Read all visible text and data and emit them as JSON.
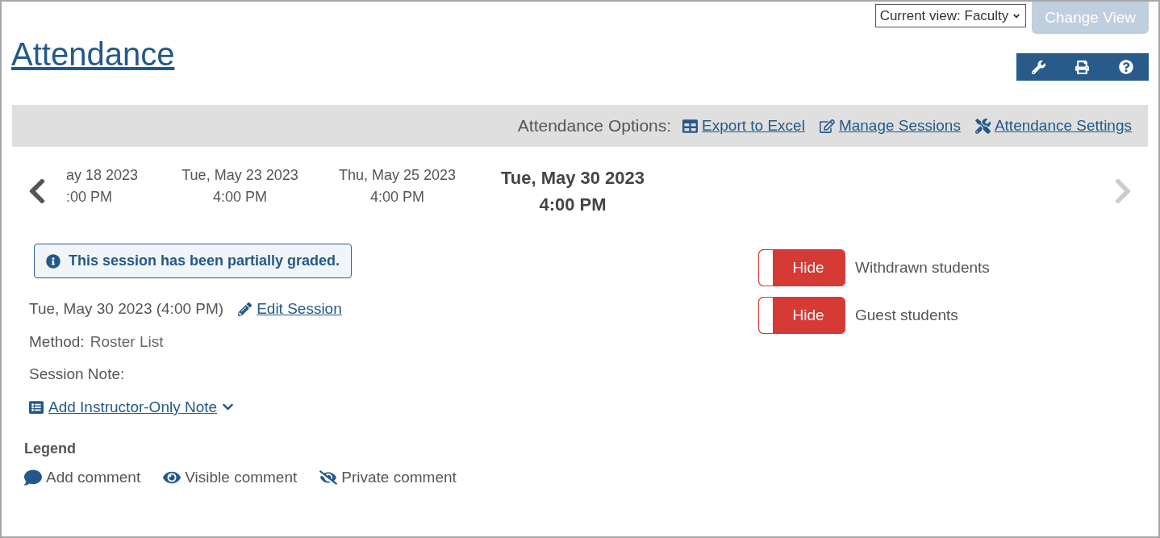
{
  "page": {
    "title": "Attendance"
  },
  "view_select": {
    "value": "Current view: Faculty"
  },
  "change_view_button": {
    "label": "Change View",
    "disabled": true
  },
  "options_bar": {
    "label": "Attendance Options:",
    "links": [
      {
        "kind": "excel",
        "label": "Export to Excel"
      },
      {
        "kind": "manage",
        "label": "Manage Sessions"
      },
      {
        "kind": "settings",
        "label": "Attendance Settings"
      }
    ]
  },
  "sessions": [
    {
      "date": "ay 18 2023",
      "time": ":00 PM",
      "selected": false
    },
    {
      "date": "Tue, May 23 2023",
      "time": "4:00 PM",
      "selected": false
    },
    {
      "date": "Thu, May 25 2023",
      "time": "4:00 PM",
      "selected": false
    },
    {
      "date": "Tue, May 30 2023",
      "time": "4:00 PM",
      "selected": true
    }
  ],
  "next_disabled": true,
  "notice": "This session has been partially graded.",
  "session": {
    "datetime": "Tue, May 30 2023 (4:00 PM)",
    "edit_link": "Edit Session",
    "method_label": "Method:",
    "method_value": "Roster List",
    "note_label": "Session Note:",
    "add_note_link": "Add Instructor-Only Note"
  },
  "toggles": [
    {
      "state_label": "Hide",
      "on": true,
      "label": "Withdrawn students"
    },
    {
      "state_label": "Hide",
      "on": true,
      "label": "Guest students"
    }
  ],
  "legend": {
    "title": "Legend",
    "items": [
      {
        "kind": "add",
        "label": "Add comment"
      },
      {
        "kind": "visible",
        "label": "Visible comment"
      },
      {
        "kind": "private",
        "label": "Private comment"
      }
    ]
  }
}
